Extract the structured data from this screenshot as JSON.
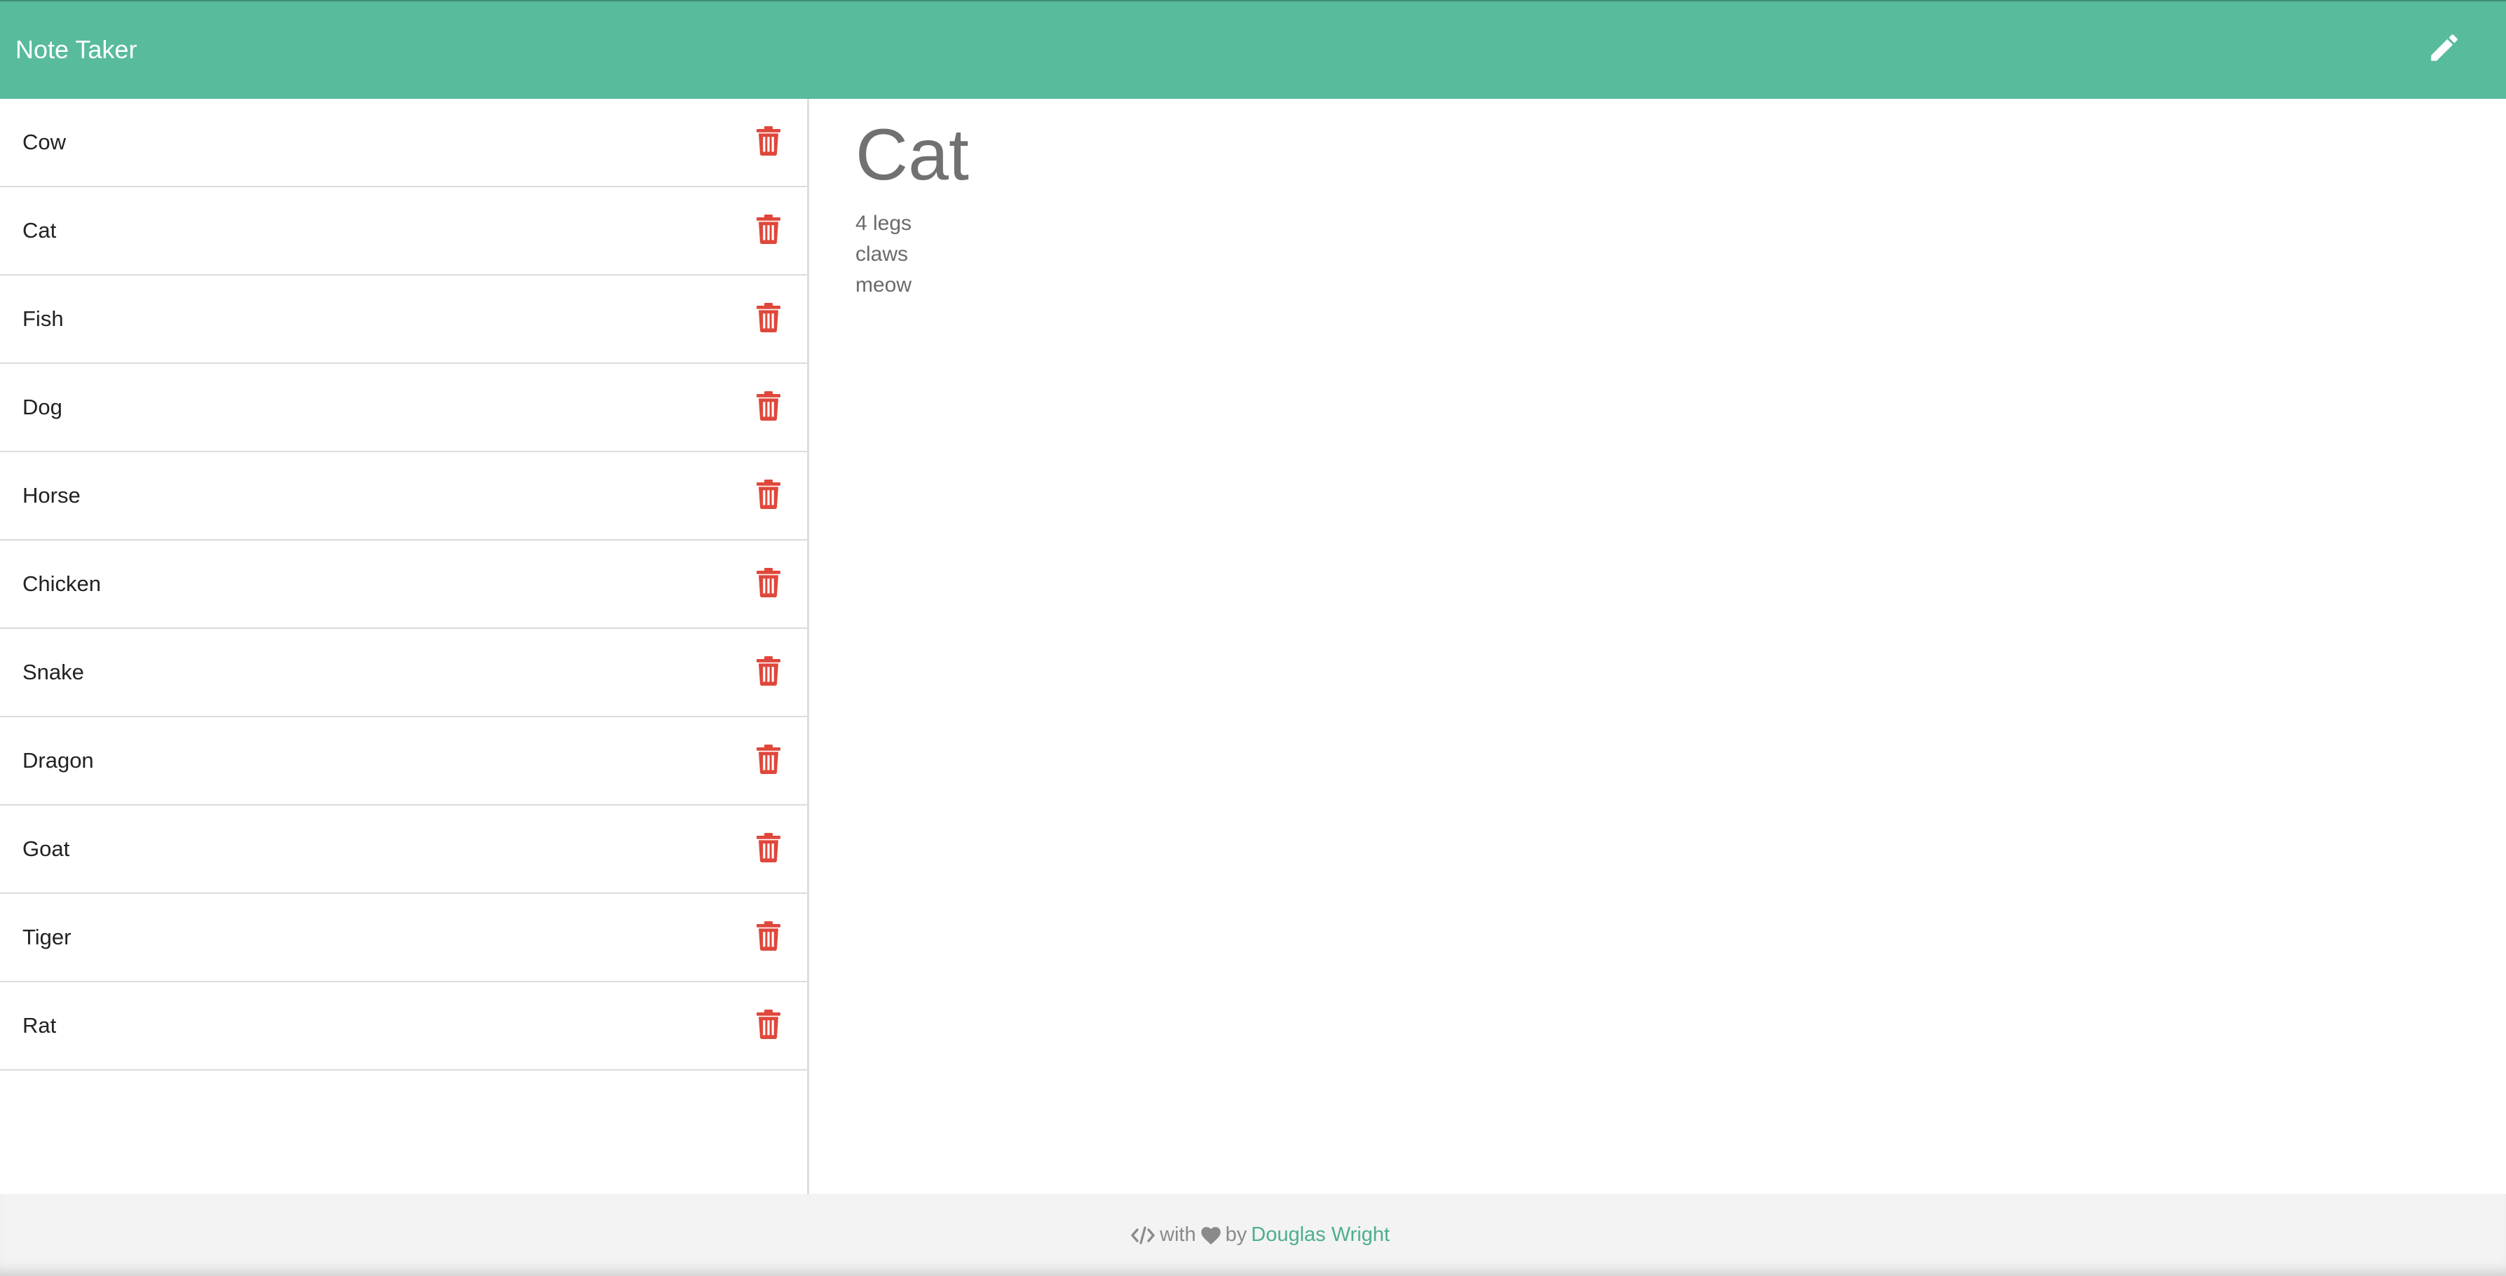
{
  "navbar": {
    "brand": "Note Taker",
    "new_note_icon": "pencil-icon",
    "background": "#58bb9d"
  },
  "notes": [
    {
      "title": "Cow"
    },
    {
      "title": "Cat"
    },
    {
      "title": "Fish"
    },
    {
      "title": "Dog"
    },
    {
      "title": "Horse"
    },
    {
      "title": "Chicken"
    },
    {
      "title": "Snake"
    },
    {
      "title": "Dragon"
    },
    {
      "title": "Goat"
    },
    {
      "title": "Tiger"
    },
    {
      "title": "Rat"
    }
  ],
  "delete_icon": {
    "name": "trash-icon",
    "color": "#e0473b"
  },
  "active_note": {
    "title": "Cat",
    "lines": [
      "4 legs",
      "claws",
      "meow"
    ]
  },
  "footer": {
    "code_icon": "code-icon",
    "with": "with",
    "heart_icon": "heart-icon",
    "by": "by",
    "author": "Douglas Wright",
    "author_color": "#4dae8f"
  }
}
